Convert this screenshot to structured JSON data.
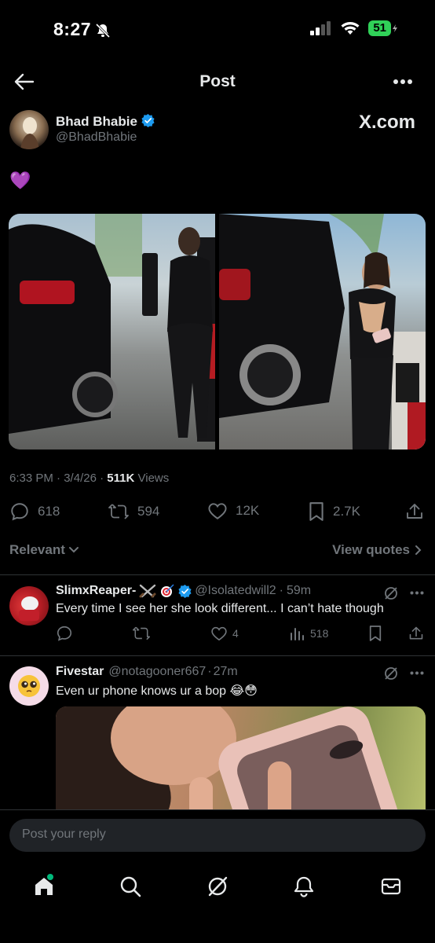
{
  "status": {
    "time": "8:27",
    "battery": "51"
  },
  "header": {
    "title": "Post"
  },
  "post": {
    "author_name": "Bhad Bhabie",
    "author_handle": "@BhadBhabie",
    "source_label": "X.com",
    "text": "💜",
    "time": "6:33 PM",
    "date": "3/4/26",
    "views_count": "511K",
    "views_label": "Views",
    "replies": "618",
    "reposts": "594",
    "likes": "12K",
    "bookmarks": "2.7K"
  },
  "sort": {
    "label": "Relevant",
    "view_quotes": "View quotes"
  },
  "replies": [
    {
      "name": "SlimxReaper-",
      "handle": "@Isolatedwill2",
      "time": "59m",
      "text": "Every time I see her she look different... I can’t hate though",
      "likes": "4",
      "views": "518"
    },
    {
      "name": "Fivestar",
      "handle": "@notagooner667",
      "time": "27m",
      "text": "Even ur phone knows ur a bop 😂😳"
    }
  ],
  "composer": {
    "placeholder": "Post your reply"
  },
  "colors": {
    "background": "#000000",
    "text": "#e7e9ea",
    "muted": "#71767b",
    "divider": "#2f3336",
    "verified": "#1d9bf0",
    "accent_green": "#00ba7c"
  }
}
